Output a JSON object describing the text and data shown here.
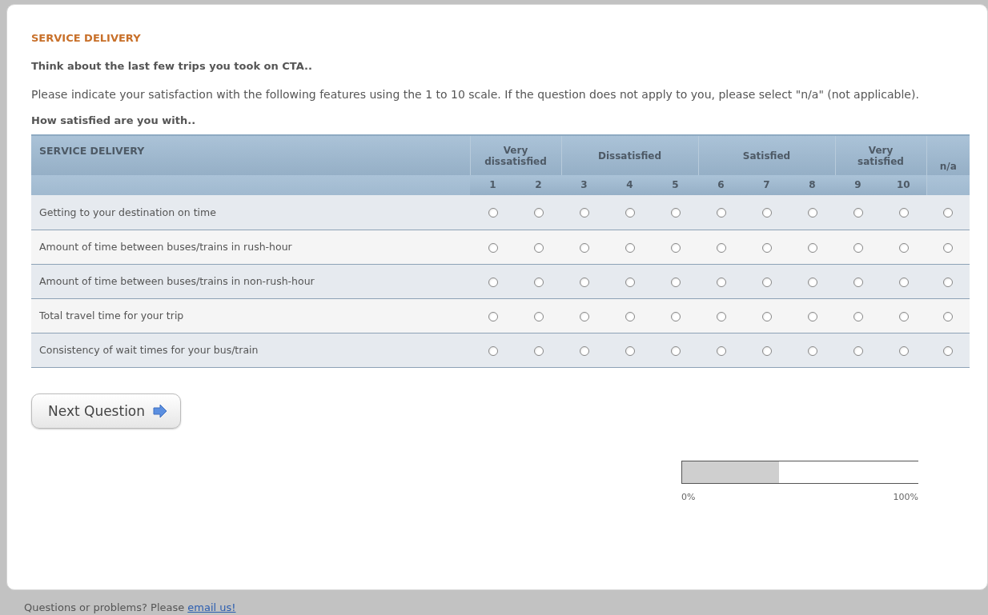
{
  "section_title": "SERVICE DELIVERY",
  "intro": "Think about the last few trips you took on CTA..",
  "instructions": "Please indicate your satisfaction with the following features using the 1 to 10 scale. If the question does not apply to you, please select \"n/a\" (not applicable).",
  "question": "How satisfied are you with..",
  "table": {
    "heading": "SERVICE DELIVERY",
    "groups": [
      {
        "label": "Very dissatisfied",
        "scale": [
          "1",
          "2"
        ]
      },
      {
        "label": "Dissatisfied",
        "scale": [
          "3",
          "4",
          "5"
        ]
      },
      {
        "label": "Satisfied",
        "scale": [
          "6",
          "7",
          "8"
        ]
      },
      {
        "label": "Very satisfied",
        "scale": [
          "9",
          "10"
        ]
      },
      {
        "label": "n/a"
      }
    ],
    "rows": [
      {
        "label": "Getting to your destination on time",
        "options": [
          {
            "selected": false
          },
          {
            "selected": false
          },
          {
            "selected": false
          },
          {
            "selected": false
          },
          {
            "selected": false
          },
          {
            "selected": false
          },
          {
            "selected": false
          },
          {
            "selected": false
          },
          {
            "selected": false
          },
          {
            "selected": false
          },
          {
            "selected": false
          }
        ]
      },
      {
        "label": "Amount of time between buses/trains in rush-hour",
        "options": [
          {
            "selected": false
          },
          {
            "selected": false
          },
          {
            "selected": false
          },
          {
            "selected": false
          },
          {
            "selected": false
          },
          {
            "selected": false
          },
          {
            "selected": false
          },
          {
            "selected": false
          },
          {
            "selected": false
          },
          {
            "selected": false
          },
          {
            "selected": false
          }
        ]
      },
      {
        "label": "Amount of time between buses/trains in non-rush-hour",
        "options": [
          {
            "selected": false
          },
          {
            "selected": false
          },
          {
            "selected": false
          },
          {
            "selected": false
          },
          {
            "selected": false
          },
          {
            "selected": false
          },
          {
            "selected": false
          },
          {
            "selected": false
          },
          {
            "selected": false
          },
          {
            "selected": false
          },
          {
            "selected": false
          }
        ]
      },
      {
        "label": "Total travel time for your trip",
        "options": [
          {
            "selected": false
          },
          {
            "selected": false
          },
          {
            "selected": false
          },
          {
            "selected": false
          },
          {
            "selected": false
          },
          {
            "selected": false
          },
          {
            "selected": false
          },
          {
            "selected": false
          },
          {
            "selected": false
          },
          {
            "selected": false
          },
          {
            "selected": false
          }
        ]
      },
      {
        "label": "Consistency of wait times for your bus/train",
        "options": [
          {
            "selected": false
          },
          {
            "selected": false
          },
          {
            "selected": false
          },
          {
            "selected": false
          },
          {
            "selected": false
          },
          {
            "selected": false
          },
          {
            "selected": false
          },
          {
            "selected": false
          },
          {
            "selected": false
          },
          {
            "selected": false
          },
          {
            "selected": false
          }
        ]
      }
    ]
  },
  "next_button": "Next Question",
  "progress": {
    "level": 0.41,
    "min_label": "0%",
    "max_label": "100%"
  },
  "footer": {
    "text": "Questions or problems? Please",
    "link": "email us!"
  }
}
